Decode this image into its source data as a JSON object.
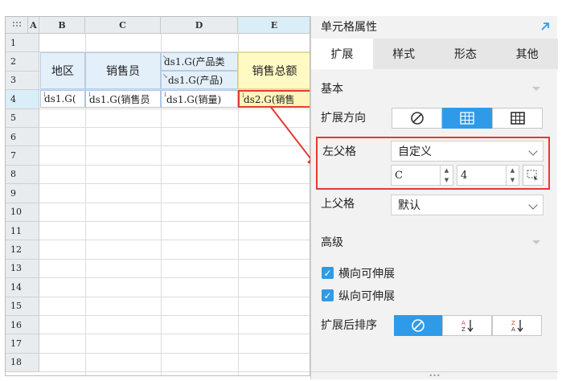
{
  "sheet": {
    "corner_icon": "grid-dots-icon",
    "columns": [
      "A",
      "B",
      "C",
      "D",
      "E"
    ],
    "rows": [
      "1",
      "2",
      "3",
      "4",
      "5",
      "6",
      "7",
      "8",
      "9",
      "10",
      "11",
      "12",
      "13",
      "14",
      "15",
      "16",
      "17",
      "18"
    ],
    "selected_column": "E",
    "selected_row": "4",
    "header_cells": {
      "region": "地区",
      "salesperson": "销售员",
      "product_category": "ds1.G(产品类",
      "product": "ds1.G(产品)",
      "total_sales": "销售总额"
    },
    "data_cells": {
      "b4": "ds1.G(",
      "c4": "ds1.G(销售员",
      "d4": "ds1.G(销量)",
      "e4": "ds2.G(销售"
    },
    "colors": {
      "highlight_border": "#e53935",
      "header_fill": "#e3eff9",
      "selected_fill": "#fff5b8"
    }
  },
  "panel": {
    "title": "单元格属性",
    "corner_icon": "expand-arrow-icon",
    "tabs": [
      "扩展",
      "样式",
      "形态",
      "其他"
    ],
    "active_tab": "扩展",
    "basic_section": "基本",
    "expand_direction_label": "扩展方向",
    "expand_direction_options": [
      "no-expand-icon",
      "vertical-expand-icon",
      "horizontal-expand-icon"
    ],
    "left_parent_label": "左父格",
    "left_parent_value": "自定义",
    "left_parent_column": "C",
    "left_parent_row": "4",
    "top_parent_label": "上父格",
    "top_parent_value": "默认",
    "advanced_section": "高级",
    "horizontal_expandable": "横向可伸展",
    "vertical_expandable": "纵向可伸展",
    "sort_label": "扩展后排序",
    "sort_options": [
      "no-sort-icon",
      "sort-ascending-icon",
      "sort-descending-icon"
    ],
    "accent_color": "#2f9be8"
  }
}
